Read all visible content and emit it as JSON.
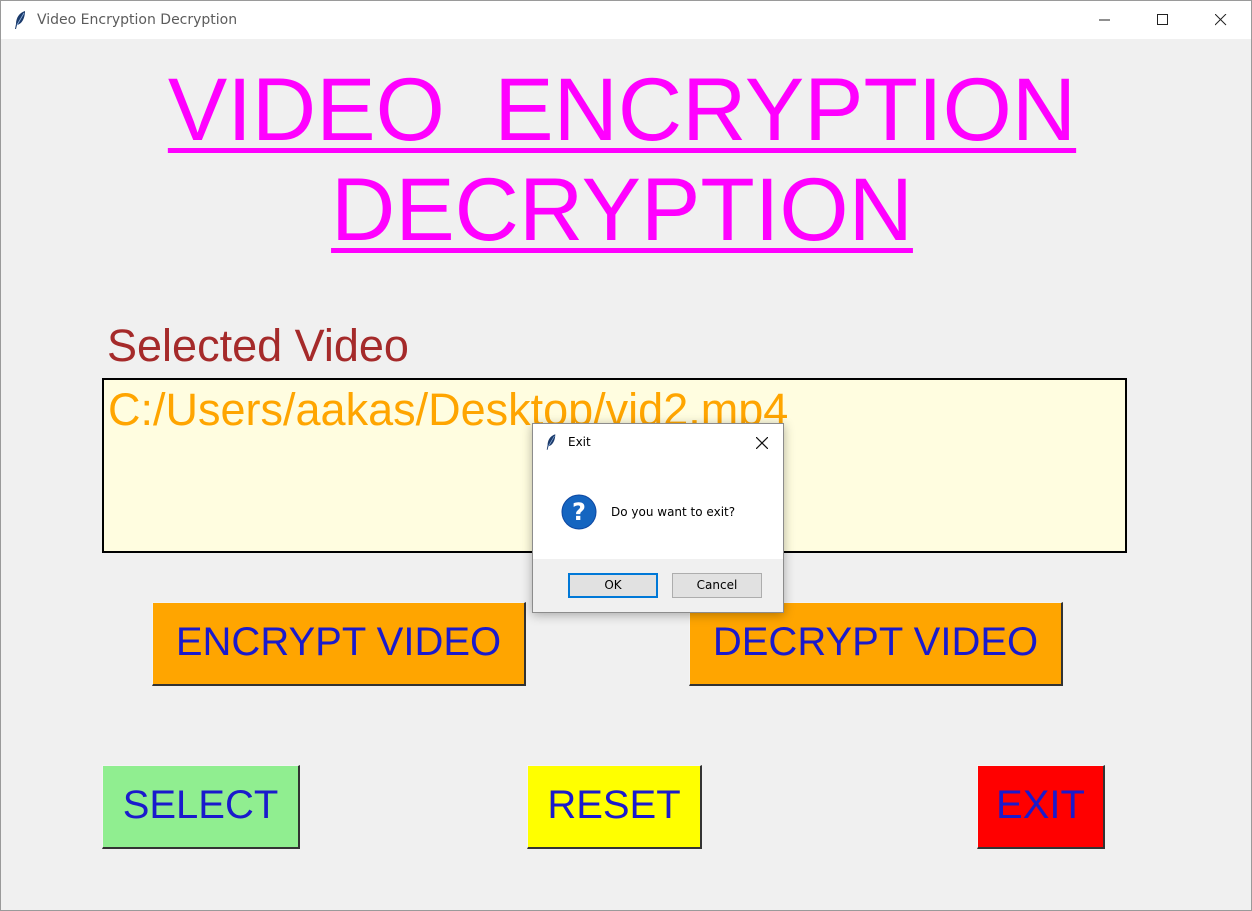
{
  "window": {
    "title": "Video Encryption Decryption"
  },
  "main": {
    "heading_line1": "VIDEO  ENCRYPTION",
    "heading_line2": "DECRYPTION",
    "selected_label": "Selected Video",
    "selected_path": "C:/Users/aakas/Desktop/vid2.mp4"
  },
  "buttons": {
    "encrypt": "ENCRYPT VIDEO",
    "decrypt": "DECRYPT VIDEO",
    "select": "SELECT",
    "reset": "RESET",
    "exit": "EXIT"
  },
  "dialog": {
    "title": "Exit",
    "message": "Do you want to exit?",
    "ok_label": "OK",
    "cancel_label": "Cancel",
    "icon": "question-icon"
  },
  "colors": {
    "heading": "#ff00ff",
    "label": "#a52a2a",
    "path_text": "#ffa500",
    "path_box_bg": "#fffde0",
    "button_text": "#1a1acc",
    "encrypt_bg": "#ffa500",
    "decrypt_bg": "#ffa500",
    "select_bg": "#90ee90",
    "reset_bg": "#ffff00",
    "exit_bg": "#ff0000"
  }
}
